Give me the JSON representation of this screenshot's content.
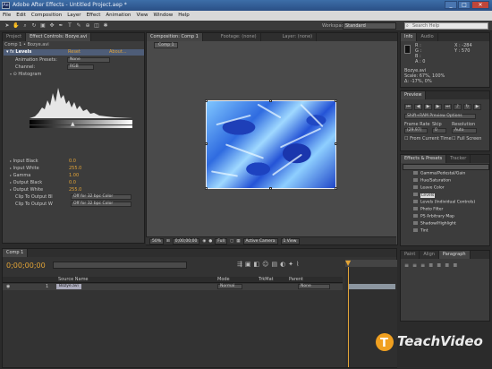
{
  "window": {
    "title": "Adobe After Effects - Untitled Project.aep *",
    "logo": "Ae",
    "minimize": "_",
    "maximize": "□",
    "close": "✕"
  },
  "menu": [
    "File",
    "Edit",
    "Composition",
    "Layer",
    "Effect",
    "Animation",
    "View",
    "Window",
    "Help"
  ],
  "toolbar": {
    "workspace_label": "Workspace:",
    "workspace_value": "Standard",
    "search_placeholder": "Search Help"
  },
  "left_panel": {
    "tabs": [
      "Project",
      "Effect Controls: Bozye.avi"
    ],
    "header": "Comp 1 • Bozye.avi",
    "effect_name": "Levels",
    "reset_label": "Reset",
    "about_label": "About...",
    "animation_presets_label": "Animation Presets:",
    "animation_presets_value": "None",
    "channel_label": "Channel:",
    "channel_value": "RGB",
    "histogram_label": "Histogram",
    "params": [
      {
        "label": "Input Black",
        "value": "0.0"
      },
      {
        "label": "Input White",
        "value": "255.0"
      },
      {
        "label": "Gamma",
        "value": "1.00"
      },
      {
        "label": "Output Black",
        "value": "0.0"
      },
      {
        "label": "Output White",
        "value": "255.0"
      }
    ],
    "clip_black_label": "Clip To Output Bl",
    "clip_black_value": "Off for 32 bpc Color",
    "clip_white_label": "Clip To Output W",
    "clip_white_value": "Off for 32 bpc Color"
  },
  "viewer": {
    "tabs": [
      "Composition: Comp 1",
      "Footage: (none)",
      "Layer: (none)"
    ],
    "comp_label": "Comp 1",
    "zoom": "50%",
    "timecode": "0;00;00;00",
    "resolution": "Full",
    "camera": "Active Camera",
    "view": "1 View"
  },
  "info_panel": {
    "tabs": [
      "Info",
      "Audio"
    ],
    "r": "R :",
    "g": "G :",
    "b": "B :",
    "a": "A : 0",
    "x": "X : -284",
    "y": "Y : 570",
    "file": "Bozye.avi",
    "scale": "Scale: 67%, 100%",
    "extra": "Δ: -17%, 0%"
  },
  "preview_panel": {
    "title": "Preview",
    "mode": "Shift+RAM Preview Options",
    "frame_rate_label": "Frame Rate",
    "skip_label": "Skip",
    "resolution_label": "Resolution",
    "frame_rate_value": "(29.97)",
    "skip_value": "0",
    "resolution_value": "Auto",
    "from_current": "From Current Time",
    "full_screen": "Full Screen"
  },
  "effects_panel": {
    "tabs": [
      "Effects & Presets",
      "Tracker"
    ],
    "items": [
      "Gamma/Pedestal/Gain",
      "Hue/Saturation",
      "Leave Color",
      "Levels",
      "Levels (Individual Controls)",
      "Photo Filter",
      "PS Arbitrary Map",
      "Shadow/Highlight",
      "Tint"
    ],
    "selected_index": 3
  },
  "paragraph_panel": {
    "tabs": [
      "Paint",
      "Align",
      "Paragraph"
    ]
  },
  "timeline": {
    "tab": "Comp 1",
    "timecode": "0;00;00;00",
    "columns": {
      "source": "Source Name",
      "mode": "Mode",
      "trkmat": "TrkMat",
      "parent": "Parent"
    },
    "layer": {
      "index": "1",
      "name": "Bozye.avi",
      "mode": "Normal",
      "parent": "None"
    }
  },
  "watermark": "TeachVideo",
  "colors": {
    "accent": "#e2a437",
    "selection": "#4e5d78"
  }
}
